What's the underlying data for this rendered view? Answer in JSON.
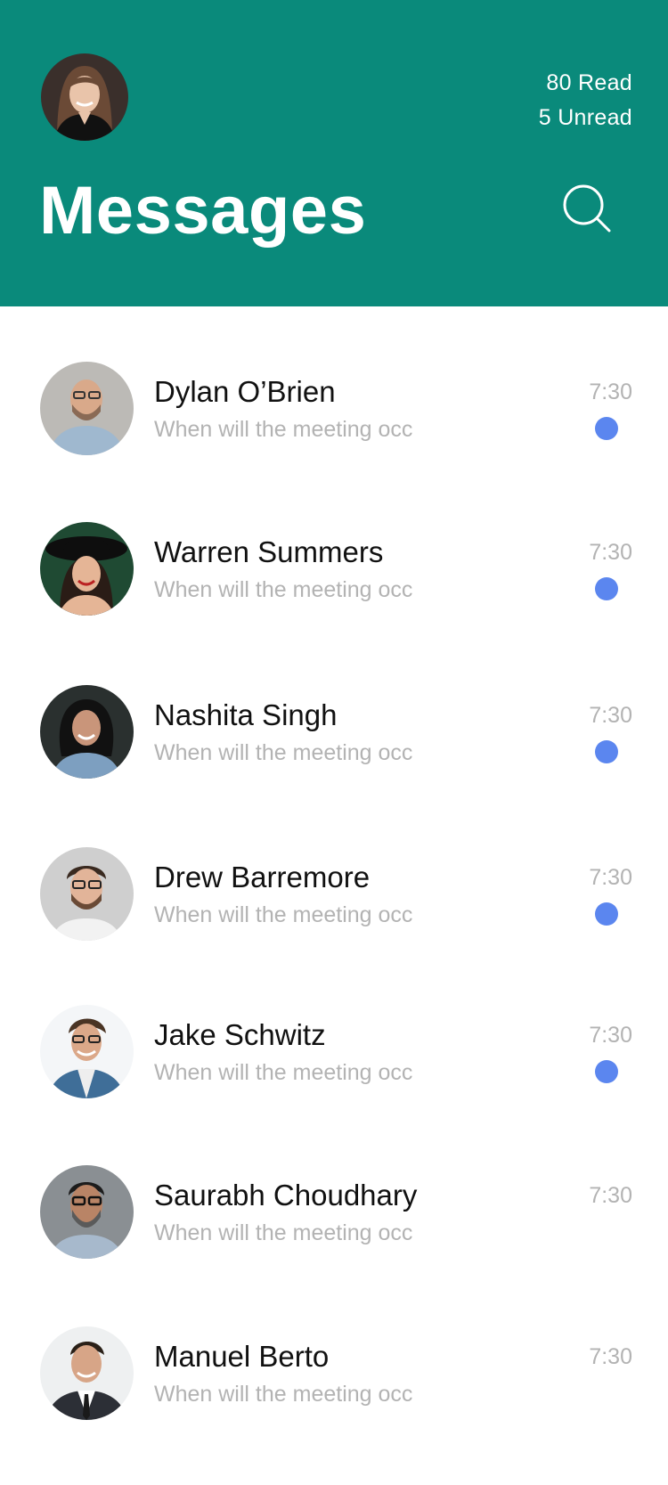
{
  "header": {
    "title": "Messages",
    "read_count": "80 Read",
    "unread_count": "5 Unread",
    "background_color": "#0a8a7b",
    "search_icon": "search-icon",
    "profile_avatar": "user-avatar"
  },
  "conversations": [
    {
      "name": "Dylan O’Brien",
      "preview": "When will the meeting occ",
      "time": "7:30",
      "unread": true
    },
    {
      "name": "Warren Summers",
      "preview": "When will the meeting occ",
      "time": "7:30",
      "unread": true
    },
    {
      "name": "Nashita Singh",
      "preview": "When will the meeting occ",
      "time": "7:30",
      "unread": true
    },
    {
      "name": "Drew Barremore",
      "preview": "When will the meeting occ",
      "time": "7:30",
      "unread": true
    },
    {
      "name": "Jake Schwitz",
      "preview": "When will the meeting occ",
      "time": "7:30",
      "unread": true
    },
    {
      "name": "Saurabh Choudhary",
      "preview": "When will the meeting occ",
      "time": "7:30",
      "unread": false
    },
    {
      "name": "Manuel Berto",
      "preview": "When will the meeting occ",
      "time": "7:30",
      "unread": false
    }
  ],
  "colors": {
    "unread_dot": "#5b86ef",
    "name_text": "#111111",
    "muted_text": "#b3b3b3"
  }
}
